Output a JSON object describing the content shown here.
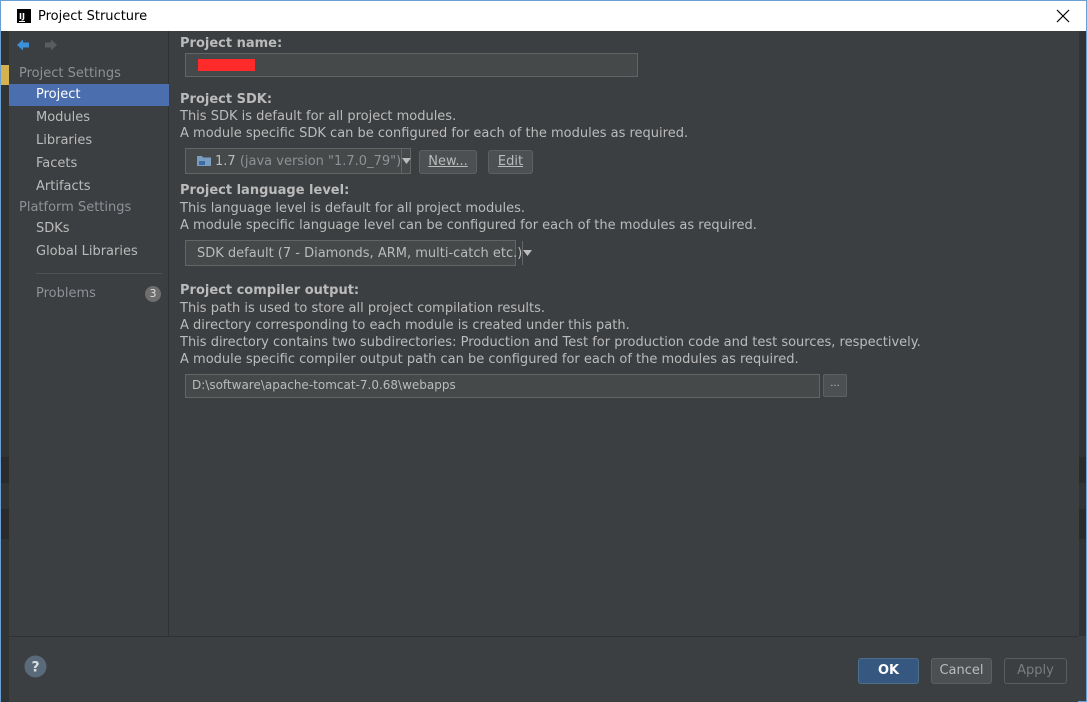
{
  "window": {
    "title": "Project Structure",
    "logo_text": "IJ"
  },
  "sidebar": {
    "sections": [
      {
        "header": "Project Settings",
        "items": [
          {
            "label": "Project",
            "selected": true
          },
          {
            "label": "Modules"
          },
          {
            "label": "Libraries"
          },
          {
            "label": "Facets"
          },
          {
            "label": "Artifacts"
          }
        ]
      },
      {
        "header": "Platform Settings",
        "items": [
          {
            "label": "SDKs"
          },
          {
            "label": "Global Libraries"
          }
        ]
      }
    ],
    "problems": {
      "label": "Problems",
      "count": "3"
    }
  },
  "project": {
    "name_label": "Project name:",
    "name_value": "",
    "sdk_label": "Project SDK:",
    "sdk_desc": [
      "This SDK is default for all project modules.",
      "A module specific SDK can be configured for each of the modules as required."
    ],
    "sdk_value": "1.7",
    "sdk_detail": "(java version \"1.7.0_79\")",
    "new_button": "New...",
    "edit_button": "Edit",
    "language_label": "Project language level:",
    "language_desc": [
      "This language level is default for all project modules.",
      "A module specific language level can be configured for each of the modules as required."
    ],
    "language_value": "SDK default (7 - Diamonds, ARM, multi-catch etc.)",
    "output_label": "Project compiler output:",
    "output_desc": [
      "This path is used to store all project compilation results.",
      "A directory corresponding to each module is created under this path.",
      "This directory contains two subdirectories: Production and Test for production code and test sources, respectively.",
      "A module specific compiler output path can be configured for each of the modules as required."
    ],
    "output_value": "D:\\software\\apache-tomcat-7.0.68\\webapps",
    "browse_button": "..."
  },
  "footer": {
    "ok": "OK",
    "cancel": "Cancel",
    "apply": "Apply"
  },
  "colors": {
    "selection": "#4b6eaf",
    "ok_button": "#365880",
    "redaction": "#ff2a2a"
  }
}
